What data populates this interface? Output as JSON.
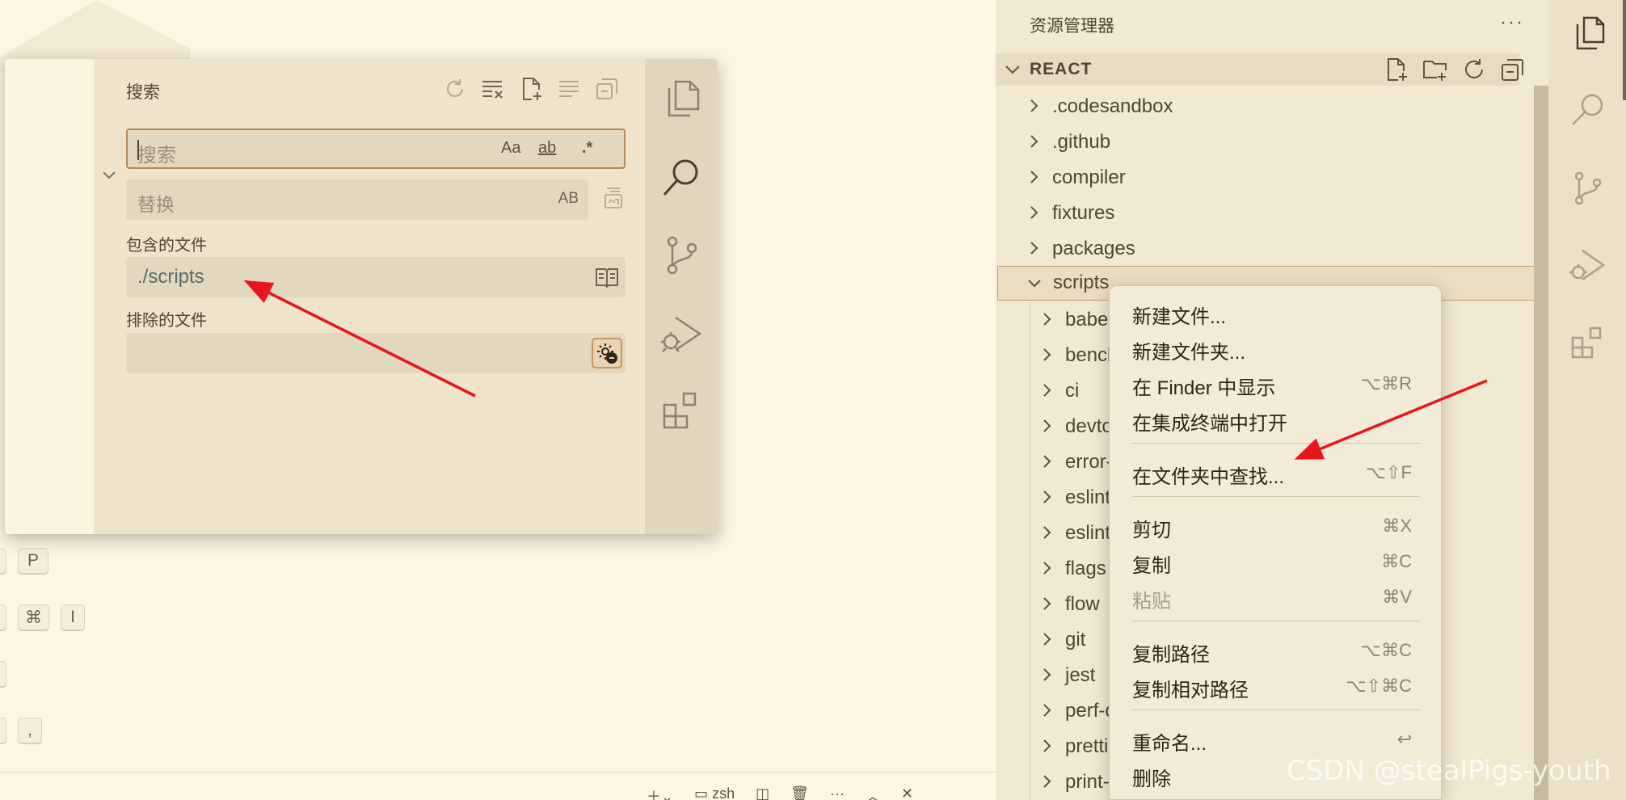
{
  "search_panel": {
    "title": "搜索",
    "search_placeholder": "搜索",
    "match_case": "Aa",
    "whole_word": "ab",
    "regex": ".*",
    "replace_placeholder": "替换",
    "preserve_case": "AB",
    "more": "···",
    "include_label": "包含的文件",
    "include_value": "./scripts",
    "exclude_label": "排除的文件",
    "exclude_value": ""
  },
  "background_keys": {
    "row1": [
      "P"
    ],
    "row2": [
      "⌘",
      "I"
    ],
    "row4": [
      ","
    ]
  },
  "bottom_bar": {
    "terminal_label": "zsh"
  },
  "explorer": {
    "title": "资源管理器",
    "more": "···",
    "section": "REACT",
    "top_items": [
      ".codesandbox",
      ".github",
      "compiler",
      "fixtures",
      "packages",
      "scripts"
    ],
    "child_items": [
      "babel",
      "bench",
      "ci",
      "devtools",
      "error-codes",
      "eslint",
      "eslint-rules",
      "flags",
      "flow",
      "git",
      "jest",
      "perf-counters",
      "prettier",
      "print-warnings"
    ]
  },
  "context_menu": {
    "items": [
      {
        "label": "新建文件...",
        "shortcut": ""
      },
      {
        "label": "新建文件夹...",
        "shortcut": ""
      },
      {
        "label": "在 Finder 中显示",
        "shortcut": "⌥⌘R"
      },
      {
        "label": "在集成终端中打开",
        "shortcut": ""
      },
      {
        "label": "在文件夹中查找...",
        "shortcut": "⌥⇧F"
      },
      {
        "label": "剪切",
        "shortcut": "⌘X"
      },
      {
        "label": "复制",
        "shortcut": "⌘C"
      },
      {
        "label": "粘贴",
        "shortcut": "⌘V",
        "disabled": true
      },
      {
        "label": "复制路径",
        "shortcut": "⌥⌘C"
      },
      {
        "label": "复制相对路径",
        "shortcut": "⌥⇧⌘C"
      },
      {
        "label": "重命名...",
        "shortcut": "↩"
      },
      {
        "label": "删除",
        "shortcut": ""
      }
    ]
  },
  "watermark": "CSDN @stealPigs-youth",
  "colors": {
    "annotation_arrow": "#e8161b",
    "focus_border": "#b68a56",
    "background": "#fbf4e3"
  }
}
